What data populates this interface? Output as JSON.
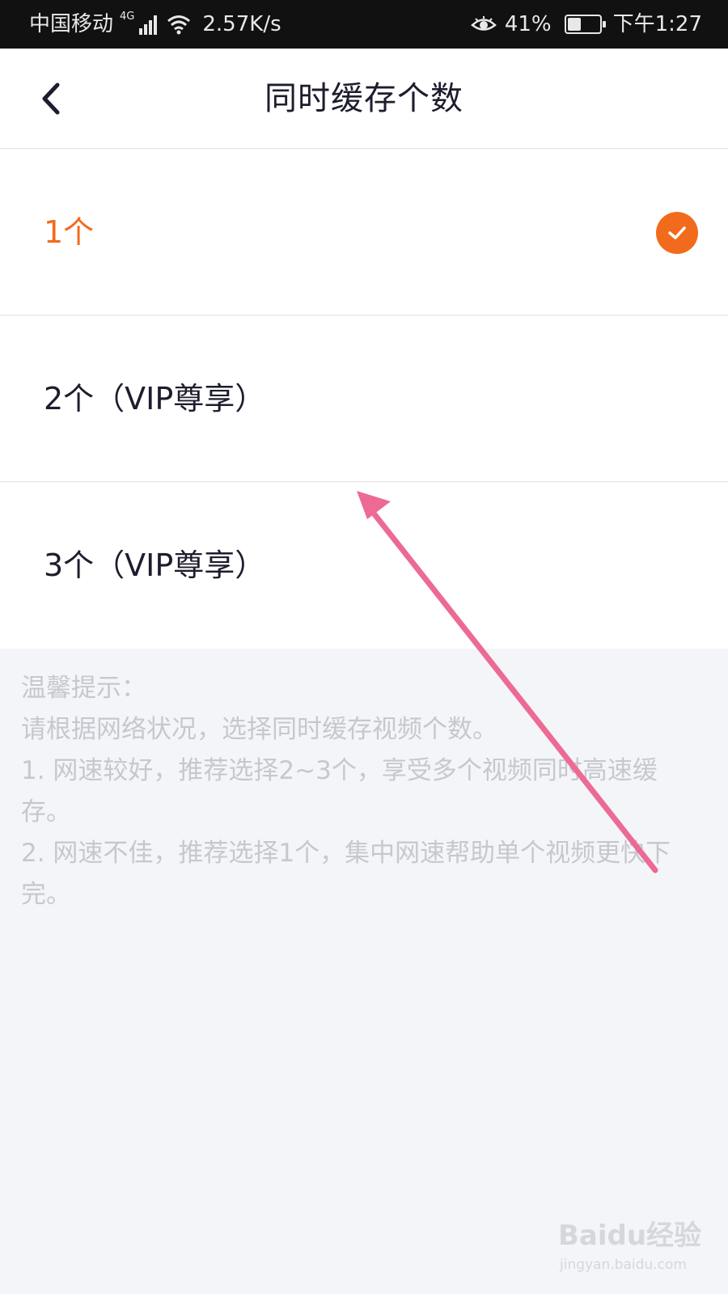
{
  "status_bar": {
    "carrier": "中国移动",
    "network_type": "4G",
    "speed": "2.57K/s",
    "battery": "41%",
    "battery_level": 0.41,
    "time": "下午1:27"
  },
  "nav": {
    "title": "同时缓存个数",
    "back_icon": "chevron-left-icon"
  },
  "options": [
    {
      "label": "1个",
      "selected": true
    },
    {
      "label": "2个（VIP尊享）",
      "selected": false
    },
    {
      "label": "3个（VIP尊享）",
      "selected": false
    }
  ],
  "tips": {
    "heading": "温馨提示：",
    "intro": "请根据网络状况，选择同时缓存视频个数。",
    "line1": "1. 网速较好，推荐选择2~3个，享受多个视频同时高速缓存。",
    "line2": "2. 网速不佳，推荐选择1个，集中网速帮助单个视频更快下完。"
  },
  "colors": {
    "accent": "#f26b1d",
    "annotation_arrow": "#ec6a93",
    "text_primary": "#1d1d2e",
    "text_hint": "#c6c8cf",
    "background": "#f4f5f8"
  },
  "watermark": {
    "logo": "Baidu经验",
    "url": "jingyan.baidu.com"
  }
}
